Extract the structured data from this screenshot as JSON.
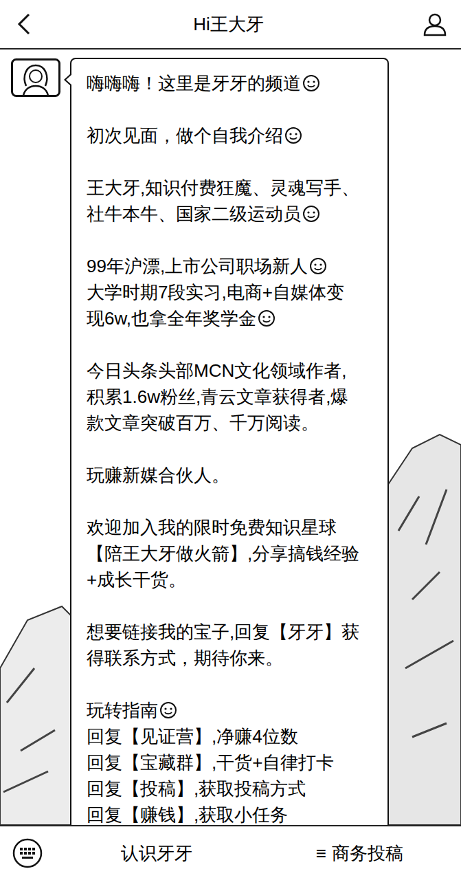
{
  "header": {
    "title": "Hi王大牙"
  },
  "message": {
    "paragraphs": [
      {
        "lines": [
          {
            "text": "嗨嗨嗨！这里是牙牙的频道",
            "kind": "emoji"
          }
        ]
      },
      {
        "lines": [
          {
            "text": "初次见面，做个自我介绍",
            "kind": "emoji"
          }
        ]
      },
      {
        "lines": [
          {
            "text": "王大牙,知识付费狂魔、灵魂写手、",
            "kind": "plain"
          },
          {
            "text": "社牛本牛、国家二级运动员",
            "kind": "emoji"
          }
        ]
      },
      {
        "lines": [
          {
            "text": "99年沪漂,上市公司职场新人",
            "kind": "emoji"
          },
          {
            "text": "大学时期7段实习,电商+自媒体变",
            "kind": "plain"
          },
          {
            "text": "现6w,也拿全年奖学金",
            "kind": "emoji"
          }
        ]
      },
      {
        "lines": [
          {
            "text": "今日头条头部MCN文化领域作者,",
            "kind": "plain"
          },
          {
            "text": "积累1.6w粉丝,青云文章获得者,爆",
            "kind": "plain"
          },
          {
            "text": "款文章突破百万、千万阅读。",
            "kind": "plain"
          }
        ]
      },
      {
        "lines": [
          {
            "text": "玩赚新媒合伙人。",
            "kind": "plain"
          }
        ]
      },
      {
        "lines": [
          {
            "text": "欢迎加入我的限时免费知识星球",
            "kind": "plain"
          },
          {
            "text": "【陪王大牙做火箭】,分享搞钱经验",
            "kind": "plain"
          },
          {
            "text": "+成长干货。",
            "kind": "plain"
          }
        ]
      },
      {
        "lines": [
          {
            "text": "想要链接我的宝子,回复【牙牙】获",
            "kind": "plain"
          },
          {
            "text": "得联系方式，期待你来。",
            "kind": "plain"
          }
        ]
      },
      {
        "lines": [
          {
            "text": "玩转指南",
            "kind": "emoji"
          },
          {
            "text": "回复【见证营】,净赚4位数",
            "kind": "plain"
          },
          {
            "text": "回复【宝藏群】,干货+自律打卡",
            "kind": "plain"
          },
          {
            "text": "回复【投稿】,获取投稿方式",
            "kind": "plain"
          },
          {
            "text": "回复【赚钱】,获取小任务",
            "kind": "plain"
          }
        ]
      }
    ]
  },
  "bottom_bar": {
    "items": [
      {
        "label": "认识牙牙"
      },
      {
        "icon": "≡",
        "label": "商务投稿"
      }
    ]
  }
}
